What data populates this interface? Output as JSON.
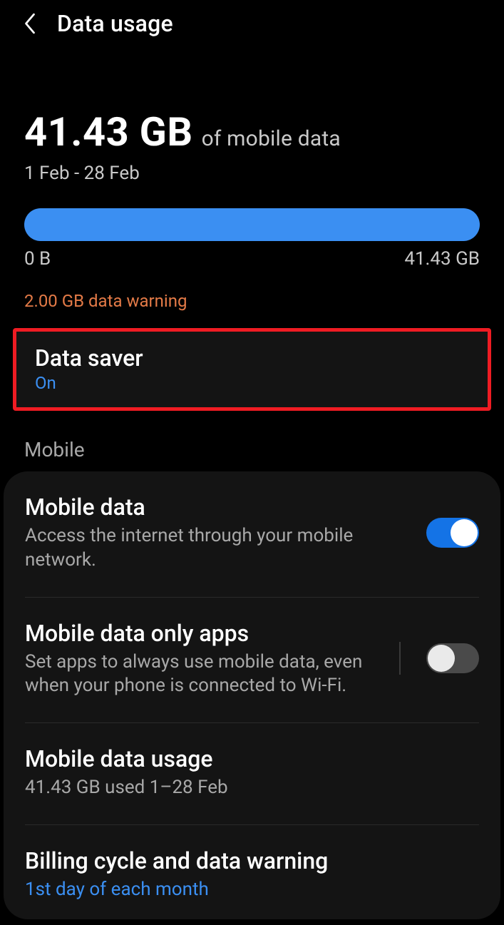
{
  "header": {
    "title": "Data usage"
  },
  "summary": {
    "amount": "41.43 GB",
    "suffix": "of mobile data",
    "period": "1 Feb - 28 Feb",
    "bar_min": "0 B",
    "bar_max": "41.43 GB",
    "warning": "2.00 GB data warning"
  },
  "data_saver": {
    "title": "Data saver",
    "status": "On"
  },
  "section_mobile": "Mobile",
  "mobile": {
    "data": {
      "title": "Mobile data",
      "sub": "Access the internet through your mobile network.",
      "on": true
    },
    "only_apps": {
      "title": "Mobile data only apps",
      "sub": "Set apps to always use mobile data, even when your phone is connected to Wi-Fi.",
      "on": false
    },
    "usage": {
      "title": "Mobile data usage",
      "sub": "41.43 GB used 1–28 Feb"
    },
    "billing": {
      "title": "Billing cycle and data warning",
      "sub": "1st day of each month"
    }
  }
}
